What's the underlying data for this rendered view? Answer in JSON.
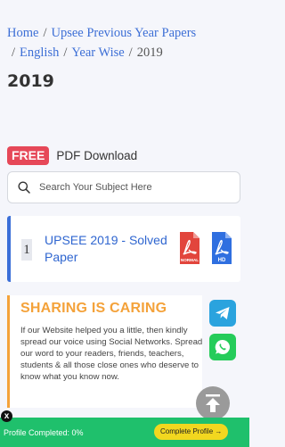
{
  "breadcrumb": {
    "items": [
      "Home",
      "Upsee Previous Year Papers",
      "English",
      "Year Wise"
    ],
    "current": "2019",
    "separator": "/"
  },
  "page": {
    "title": "2019"
  },
  "pdf_section": {
    "badge": "FREE",
    "title": "PDF Download"
  },
  "search": {
    "placeholder": "Search Your Subject Here",
    "icon": "search-icon"
  },
  "papers": [
    {
      "number": "1",
      "title": "UPSEE 2019 - Solved Paper",
      "normal_label": "NORMAL",
      "hd_label": "HD",
      "normal_color": "#e2453c",
      "hd_color": "#2f6fe0"
    }
  ],
  "share": {
    "title": "SHARING IS CARING",
    "text": "If our Website helped you a little, then kindly spread our voice using Social Networks. Spread our word to your readers, friends, teachers, students & all those close ones who deserve to know what you know now.",
    "accent": "#f4a23a"
  },
  "social": [
    "telegram-icon",
    "whatsapp-icon"
  ],
  "profile": {
    "text": "Profile Completed: 0%",
    "button": "Complete Profile →",
    "close": "x"
  },
  "colors": {
    "link": "#3d6fd6",
    "badge": "#e64858",
    "bar": "#1fc06c",
    "button": "#f2d71f"
  }
}
